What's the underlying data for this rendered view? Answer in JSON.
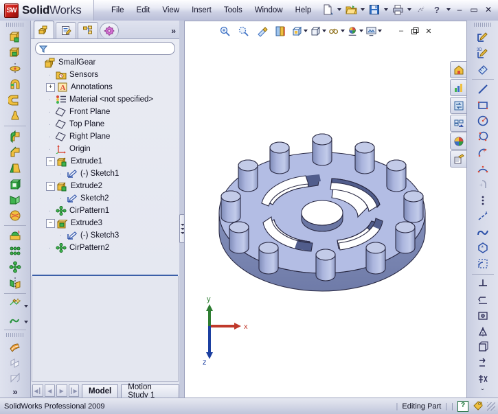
{
  "app": {
    "brand_bold": "Solid",
    "brand_light": "Works",
    "logo_text": "SW",
    "accent_red": "#c41c16",
    "accent_blue": "#3b5fa8"
  },
  "menubar": {
    "items": [
      {
        "label": "File"
      },
      {
        "label": "Edit"
      },
      {
        "label": "View"
      },
      {
        "label": "Insert"
      },
      {
        "label": "Tools"
      },
      {
        "label": "Window"
      },
      {
        "label": "Help"
      }
    ],
    "search_icon": "magnifier-icon"
  },
  "titlebar_right": {
    "buttons": [
      {
        "name": "new-document-icon",
        "has_dropdown": true
      },
      {
        "name": "open-document-icon",
        "has_dropdown": true
      },
      {
        "name": "save-icon",
        "has_dropdown": true
      },
      {
        "name": "print-icon",
        "has_dropdown": true
      },
      {
        "name": "rebuild-icon",
        "has_dropdown": false
      },
      {
        "name": "help-icon",
        "has_dropdown": true
      }
    ],
    "window_controls": [
      {
        "name": "minimize-button",
        "glyph": "–"
      },
      {
        "name": "restore-button",
        "glyph": "▭"
      },
      {
        "name": "close-button",
        "glyph": "✕"
      }
    ]
  },
  "left_toolbar": {
    "groups": [
      {
        "name": "features-group",
        "tools": [
          {
            "name": "extruded-boss-base-icon"
          },
          {
            "name": "extruded-cut-icon"
          },
          {
            "name": "revolved-boss-base-icon"
          },
          {
            "name": "swept-boss-base-icon"
          },
          {
            "name": "lofted-boss-base-icon"
          },
          {
            "name": "boundary-boss-base-icon"
          }
        ]
      },
      {
        "name": "modify-group",
        "tools": [
          {
            "name": "fillet-icon"
          },
          {
            "name": "chamfer-icon"
          },
          {
            "name": "draft-icon"
          },
          {
            "name": "shell-icon"
          },
          {
            "name": "rib-icon"
          },
          {
            "name": "wrap-icon"
          }
        ]
      },
      {
        "name": "pattern-group",
        "tools": [
          {
            "name": "dome-icon"
          },
          {
            "name": "linear-pattern-icon"
          },
          {
            "name": "circular-pattern-icon"
          },
          {
            "name": "mirror-icon"
          }
        ]
      },
      {
        "name": "reference-group",
        "tools": [
          {
            "name": "reference-geometry-icon",
            "has_dropdown": true
          },
          {
            "name": "curves-icon",
            "has_dropdown": true
          }
        ]
      },
      {
        "name": "instant3d-group",
        "tools": [
          {
            "name": "instant3d-icon"
          },
          {
            "name": "move-face-icon"
          },
          {
            "name": "intersect-icon"
          }
        ]
      }
    ],
    "overflow_glyph": "»"
  },
  "right_toolbar": {
    "groups": [
      {
        "name": "sketch-group",
        "tools": [
          {
            "name": "sketch-icon"
          },
          {
            "name": "3d-sketch-icon"
          },
          {
            "name": "smart-dimension-icon"
          }
        ]
      },
      {
        "name": "entities-group",
        "tools": [
          {
            "name": "line-icon"
          },
          {
            "name": "rectangle-icon"
          },
          {
            "name": "circle-icon"
          },
          {
            "name": "perimeter-circle-icon"
          },
          {
            "name": "centerpoint-arc-icon"
          },
          {
            "name": "3point-arc-icon"
          },
          {
            "name": "tangent-arc-icon"
          },
          {
            "name": "point-icon"
          },
          {
            "name": "centerline-icon"
          },
          {
            "name": "spline-icon"
          },
          {
            "name": "polygon-icon"
          },
          {
            "name": "sketch-fillet-icon"
          }
        ]
      },
      {
        "name": "relations-group",
        "tools": [
          {
            "name": "trim-entities-icon"
          },
          {
            "name": "convert-entities-icon"
          },
          {
            "name": "offset-entities-icon"
          },
          {
            "name": "mirror-entities-icon"
          },
          {
            "name": "linear-sketch-pattern-icon"
          },
          {
            "name": "move-entities-icon"
          },
          {
            "name": "display-delete-relations-icon"
          }
        ]
      }
    ],
    "overflow_glyph": "ˇ"
  },
  "feature_manager": {
    "tabs": [
      {
        "name": "feature-manager-design-tree-tab",
        "label": "FeatureManager design tree",
        "active": true
      },
      {
        "name": "property-manager-tab",
        "label": "PropertyManager",
        "active": false
      },
      {
        "name": "configuration-manager-tab",
        "label": "ConfigurationManager",
        "active": false
      },
      {
        "name": "dimxpert-manager-tab",
        "label": "DimXpertManager",
        "active": false
      }
    ],
    "more_tabs_glyph": "»",
    "filter": {
      "placeholder": "",
      "value": "",
      "icon": "filter-icon"
    },
    "tree": [
      {
        "label": "SmallGear",
        "icon": "part-icon",
        "indent": 0,
        "expander": "",
        "root": true
      },
      {
        "label": "Sensors",
        "icon": "sensors-folder-icon",
        "indent": 1,
        "expander": ""
      },
      {
        "label": "Annotations",
        "icon": "annotations-icon",
        "indent": 1,
        "expander": "+"
      },
      {
        "label": "Material <not specified>",
        "icon": "material-icon",
        "indent": 1,
        "expander": ""
      },
      {
        "label": "Front Plane",
        "icon": "plane-icon",
        "indent": 1,
        "expander": ""
      },
      {
        "label": "Top Plane",
        "icon": "plane-icon",
        "indent": 1,
        "expander": ""
      },
      {
        "label": "Right Plane",
        "icon": "plane-icon",
        "indent": 1,
        "expander": ""
      },
      {
        "label": "Origin",
        "icon": "origin-icon",
        "indent": 1,
        "expander": ""
      },
      {
        "label": "Extrude1",
        "icon": "extrude-boss-icon",
        "indent": 1,
        "expander": "−"
      },
      {
        "label": "(-) Sketch1",
        "icon": "sketch-small-icon",
        "indent": 2,
        "expander": ""
      },
      {
        "label": "Extrude2",
        "icon": "extrude-boss-icon",
        "indent": 1,
        "expander": "−"
      },
      {
        "label": "Sketch2",
        "icon": "sketch-small-icon",
        "indent": 2,
        "expander": ""
      },
      {
        "label": "CirPattern1",
        "icon": "circular-pattern-tree-icon",
        "indent": 1,
        "expander": ""
      },
      {
        "label": "Extrude3",
        "icon": "extrude-cut-icon",
        "indent": 1,
        "expander": "−"
      },
      {
        "label": "(-) Sketch3",
        "icon": "sketch-small-icon",
        "indent": 2,
        "expander": ""
      },
      {
        "label": "CirPattern2",
        "icon": "circular-pattern-tree-icon",
        "indent": 1,
        "expander": ""
      }
    ],
    "nav_buttons": [
      {
        "name": "first-config-button",
        "glyph": "◀┃"
      },
      {
        "name": "prev-config-button",
        "glyph": "◀"
      },
      {
        "name": "next-config-button",
        "glyph": "▶"
      },
      {
        "name": "last-config-button",
        "glyph": "┃▶"
      }
    ],
    "bottom_tabs": [
      {
        "name": "tab-model",
        "label": "Model",
        "active": true
      },
      {
        "name": "tab-motion-study-1",
        "label": "Motion Study 1",
        "active": false
      }
    ]
  },
  "viewport": {
    "toolbar": [
      {
        "name": "zoom-to-fit-icon",
        "has_dropdown": false
      },
      {
        "name": "zoom-to-area-icon",
        "has_dropdown": false
      },
      {
        "name": "previous-view-icon",
        "has_dropdown": false
      },
      {
        "name": "section-view-icon",
        "has_dropdown": false
      },
      {
        "name": "view-orientation-icon",
        "has_dropdown": true
      },
      {
        "name": "display-style-icon",
        "has_dropdown": true
      },
      {
        "name": "hide-show-items-icon",
        "has_dropdown": true
      },
      {
        "name": "apply-scene-icon",
        "has_dropdown": true
      },
      {
        "name": "view-settings-icon",
        "has_dropdown": true
      }
    ],
    "window_buttons": [
      {
        "name": "doc-minimize-button",
        "glyph": "–"
      },
      {
        "name": "doc-restore-button",
        "glyph": "❐"
      },
      {
        "name": "doc-close-button",
        "glyph": "✕"
      }
    ],
    "task_pane_tabs": [
      {
        "name": "solidworks-resources-tab",
        "icon": "home-icon"
      },
      {
        "name": "design-library-tab",
        "icon": "library-chart-icon"
      },
      {
        "name": "file-explorer-tab",
        "icon": "file-explorer-icon"
      },
      {
        "name": "search-tab",
        "icon": "search-panel-icon"
      },
      {
        "name": "view-palette-tab",
        "icon": "color-wheel-icon"
      },
      {
        "name": "appearances-scenes-tab",
        "icon": "appearances-icon"
      }
    ],
    "model": {
      "name": "SmallGear",
      "body_color": "#b3bde4",
      "edge_color": "#2a2a44",
      "shadow_color": "#6e7aa8",
      "pin_count": 12,
      "spoke_window_count": 4
    },
    "triad": {
      "x_label": "x",
      "y_label": "y",
      "z_label": "z",
      "x_color": "#c0392b",
      "y_color": "#2e7d32",
      "z_color": "#1b3fa0"
    }
  },
  "statusbar": {
    "left_text": "SolidWorks Professional 2009",
    "mode_text": "Editing Part",
    "help_glyph": "?",
    "tag_icon": "tag-icon"
  }
}
